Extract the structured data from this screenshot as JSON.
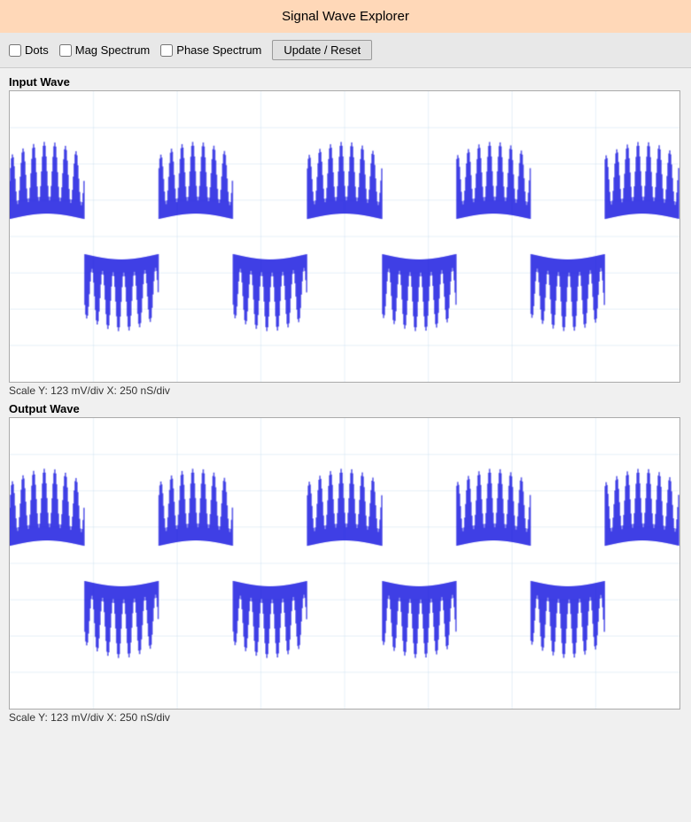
{
  "title": "Signal Wave Explorer",
  "toolbar": {
    "dots_label": "Dots",
    "mag_spectrum_label": "Mag Spectrum",
    "phase_spectrum_label": "Phase Spectrum",
    "update_reset_label": "Update / Reset",
    "dots_checked": false,
    "mag_spectrum_checked": false,
    "phase_spectrum_checked": false
  },
  "input_wave": {
    "label": "Input Wave",
    "scale": "Scale  Y: 123 mV/div   X: 250 nS/div"
  },
  "output_wave": {
    "label": "Output Wave",
    "scale": "Scale  Y: 123 mV/div   X: 250 nS/div"
  }
}
